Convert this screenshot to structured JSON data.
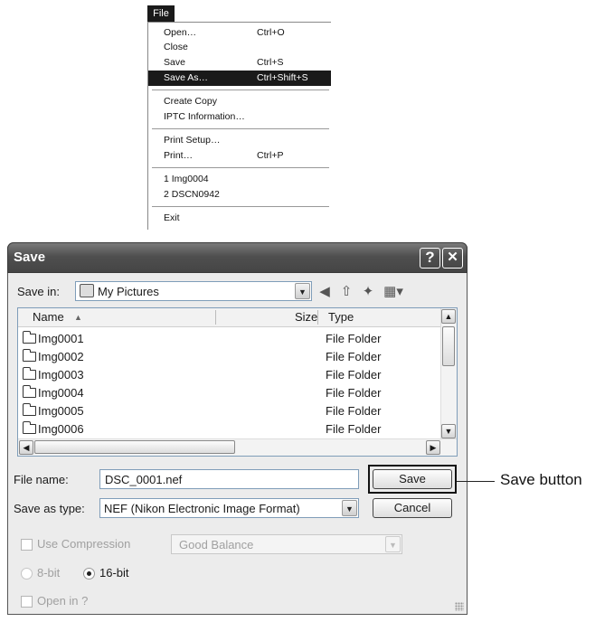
{
  "menu": {
    "title": "File",
    "items": [
      {
        "label": "Open…",
        "shortcut": "Ctrl+O"
      },
      {
        "label": "Close",
        "shortcut": ""
      },
      {
        "label": "Save",
        "shortcut": "Ctrl+S"
      },
      {
        "label": "Save As…",
        "shortcut": "Ctrl+Shift+S"
      },
      {
        "label": "Create Copy",
        "shortcut": ""
      },
      {
        "label": "IPTC Information…",
        "shortcut": ""
      },
      {
        "label": "Print Setup…",
        "shortcut": ""
      },
      {
        "label": "Print…",
        "shortcut": "Ctrl+P"
      },
      {
        "label": "1 Img0004",
        "shortcut": ""
      },
      {
        "label": "2 DSCN0942",
        "shortcut": ""
      },
      {
        "label": "Exit",
        "shortcut": ""
      }
    ]
  },
  "dialog": {
    "title": "Save",
    "help_label": "?",
    "close_label": "✕",
    "save_in": {
      "label": "Save in:",
      "value": "My Pictures"
    },
    "list": {
      "headers": {
        "name": "Name",
        "size": "Size",
        "type": "Type"
      },
      "rows": [
        {
          "name": "Img0001",
          "type": "File Folder"
        },
        {
          "name": "Img0002",
          "type": "File Folder"
        },
        {
          "name": "Img0003",
          "type": "File Folder"
        },
        {
          "name": "Img0004",
          "type": "File Folder"
        },
        {
          "name": "Img0005",
          "type": "File Folder"
        },
        {
          "name": "Img0006",
          "type": "File Folder"
        }
      ]
    },
    "file_name": {
      "label": "File name:",
      "value": "DSC_0001.nef"
    },
    "save_as_type": {
      "label": "Save as type:",
      "value": "NEF (Nikon Electronic Image Format)"
    },
    "save_button": "Save",
    "cancel_button": "Cancel",
    "use_compression": {
      "label": "Use Compression",
      "value": "Good Balance"
    },
    "bit_8": "8-bit",
    "bit_16": "16-bit",
    "open_in": "Open in ?"
  },
  "callout": "Save button",
  "icons": [
    "back-icon",
    "up-folder-icon",
    "new-folder-icon",
    "views-menu-icon",
    "folder-icon"
  ]
}
